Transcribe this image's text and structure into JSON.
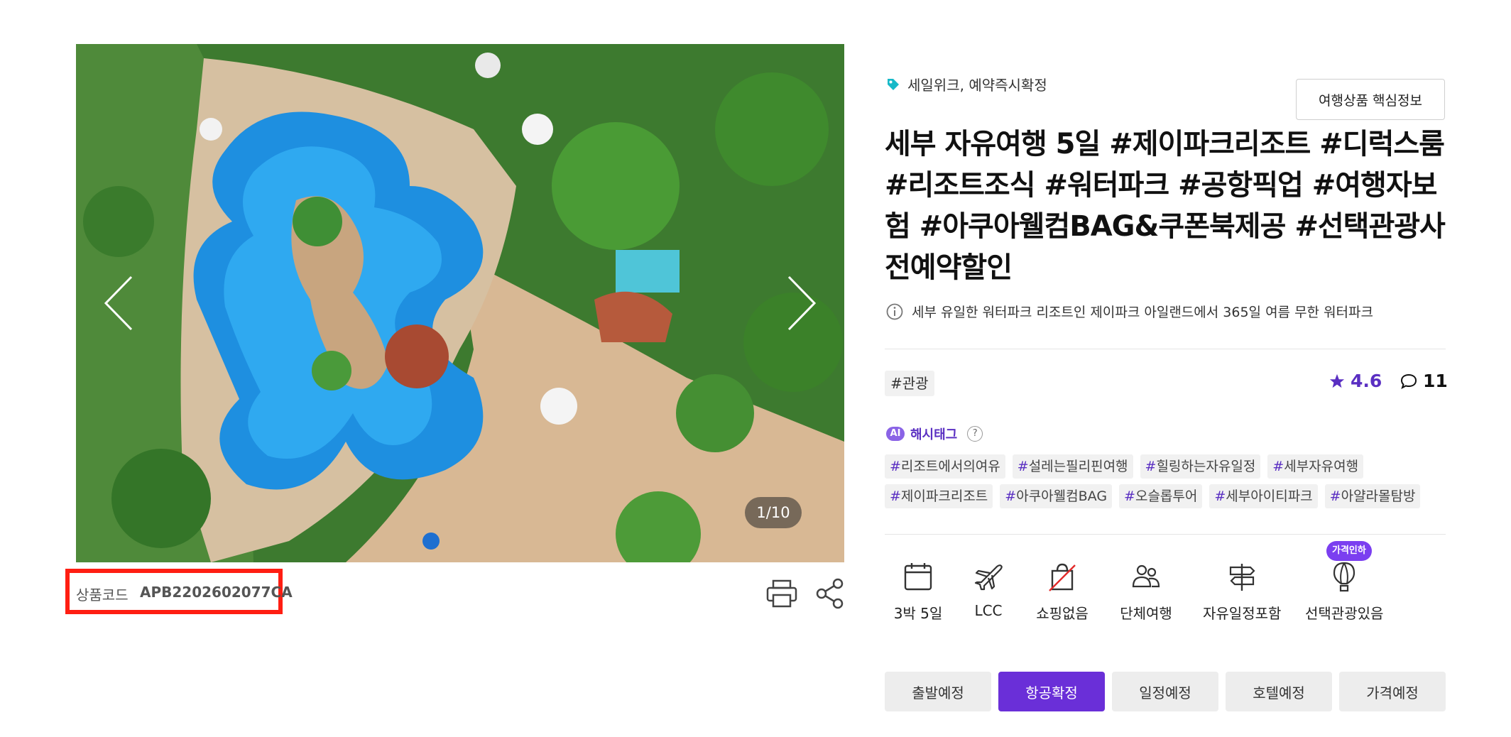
{
  "gallery": {
    "counter": "1/10",
    "prev_icon": "chevron-left-icon",
    "next_icon": "chevron-right-icon"
  },
  "product_code": {
    "label": "상품코드",
    "value": "APB2202602077CA"
  },
  "actions": {
    "print_icon": "printer-icon",
    "share_icon": "share-icon"
  },
  "header": {
    "tag_icon": "tag-icon",
    "tag_text": "세일위크, 예약즉시확정",
    "core_info_button": "여행상품 핵심정보"
  },
  "title": "세부 자유여행 5일 #제이파크리조트 #디럭스룸 #리조트조식 #워터파크 #공항픽업 #여행자보험 #아쿠아웰컴BAG&쿠폰북제공 #선택관광사전예약할인",
  "subtitle": "세부 유일한 워터파크 리조트인 제이파크 아일랜드에서 365일 여름 무한 워터파크",
  "category": "#관광",
  "rating": "4.6",
  "reviews": "11",
  "ai_hashtags": {
    "badge": "AI",
    "label": "해시태그",
    "help": "?",
    "tags": [
      "리조트에서의여유",
      "설레는필리핀여행",
      "힐링하는자유일정",
      "세부자유여행",
      "제이파크리조트",
      "아쿠아웰컴BAG",
      "오슬롭투어",
      "세부아이티파크",
      "아얄라몰탐방"
    ]
  },
  "features": [
    {
      "label": "3박 5일",
      "icon": "calendar-icon"
    },
    {
      "label": "LCC",
      "icon": "airplane-icon"
    },
    {
      "label": "쇼핑없음",
      "icon": "no-shopping-icon"
    },
    {
      "label": "단체여행",
      "icon": "group-icon"
    },
    {
      "label": "자유일정포함",
      "icon": "signpost-icon"
    },
    {
      "label": "선택관광있음",
      "icon": "balloon-icon"
    }
  ],
  "price_down_badge": "가격인하",
  "steps": [
    {
      "label": "출발예정",
      "active": false
    },
    {
      "label": "항공확정",
      "active": true
    },
    {
      "label": "일정예정",
      "active": false
    },
    {
      "label": "호텔예정",
      "active": false
    },
    {
      "label": "가격예정",
      "active": false
    }
  ],
  "colors": {
    "accent": "#6a2fd8",
    "highlight_box": "#ff1e12",
    "tag_icon": "#17b9c8"
  }
}
